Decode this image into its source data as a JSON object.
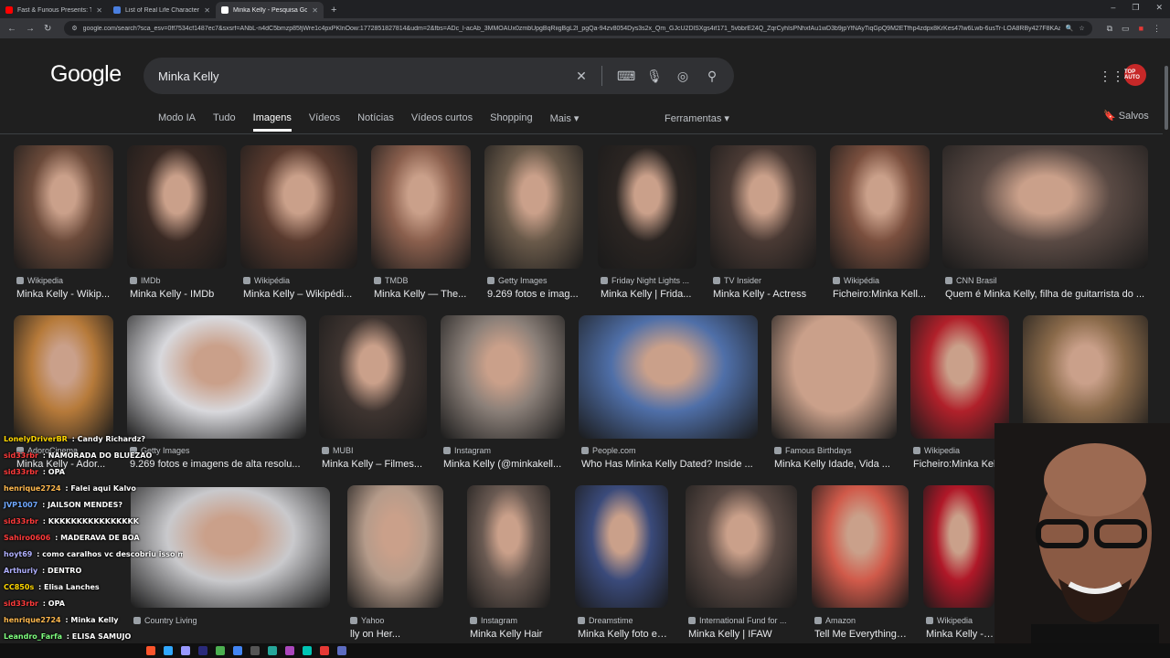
{
  "tabs": [
    {
      "title": "Fast & Furious Presents: Turbo",
      "fav": "#ff0000"
    },
    {
      "title": "List of Real Life Characters in D",
      "fav": "#4a7fe0"
    },
    {
      "title": "Minka Kelly - Pesquisa Google",
      "fav": "#ffffff"
    }
  ],
  "url": "google.com/search?sca_esv=0ff7534cf1487ec7&sxsrf=ANbL-n4dC5bmzp85fjWre1c4pxPKlnOow:1772851827814&udm=2&fbs=ADc_l-acAb_3MMOAUx0zmbUpgBqRiigBgL2l_pgQa-94zv8054Dys3s2x_Qm_GJcU2DlSXgs4if171_5vbbrE24Q_ZqrCyhIsPNhxfAu1wD3b9jpYfNAyTiqGpQ9M2ETfhp4zdpx8KrKes47lw6Lwb-6usTr-LOA8RBy427F8KAa4CS2tstri2f...",
  "search": {
    "query": "Minka Kelly"
  },
  "logo": "Google",
  "menu": [
    "Modo IA",
    "Tudo",
    "Imagens",
    "Vídeos",
    "Notícias",
    "Vídeos curtos",
    "Shopping",
    "Mais ▾"
  ],
  "tools_label": "Ferramentas ▾",
  "saved_label": "Salvos",
  "avatar_text": "TOP AUTO",
  "results": [
    {
      "source": "Wikipedia",
      "title": "Minka Kelly - Wikip...",
      "color": "#6b4a3a"
    },
    {
      "source": "IMDb",
      "title": "Minka Kelly - IMDb",
      "color": "#3a2a24"
    },
    {
      "source": "Wikipédia",
      "title": "Minka Kelly – Wikipédi...",
      "color": "#5a3b2f"
    },
    {
      "source": "TMDB",
      "title": "Minka Kelly — The...",
      "color": "#8a5f4d"
    },
    {
      "source": "Getty Images",
      "title": "9.269 fotos e imag...",
      "color": "#6a5a4a"
    },
    {
      "source": "Friday Night Lights ...",
      "title": "Minka Kelly | Frida...",
      "color": "#2b2522"
    },
    {
      "source": "TV Insider",
      "title": "Minka Kelly - Actress",
      "color": "#4a3a34"
    },
    {
      "source": "Wikipédia",
      "title": "Ficheiro:Minka Kell...",
      "color": "#7a4f3e"
    },
    {
      "source": "CNN Brasil",
      "title": "Quem é Minka Kelly, filha de guitarrista do ...",
      "color": "#5a4a44"
    },
    {
      "source": "AdoroCinema",
      "title": "Minka Kelly - Ador...",
      "color": "#b67a3a"
    },
    {
      "source": "Getty Images",
      "title": "9.269 fotos e imagens de alta resolu...",
      "color": "#d8d8dc"
    },
    {
      "source": "MUBI",
      "title": "Minka Kelly – Filmes...",
      "color": "#3e3430"
    },
    {
      "source": "Instagram",
      "title": "Minka Kelly (@minkakell...",
      "color": "#8a7f78"
    },
    {
      "source": "People.com",
      "title": "Who Has Minka Kelly Dated? Inside ...",
      "color": "#4f6fa8"
    },
    {
      "source": "Famous Birthdays",
      "title": "Minka Kelly Idade, Vida ...",
      "color": "#caa08a"
    },
    {
      "source": "Wikipedia",
      "title": "Ficheiro:Minka Kel...",
      "color": "#b0202a"
    },
    {
      "source": "",
      "title": "",
      "color": "#8a6a4a"
    },
    {
      "source": "Country Living",
      "title": "",
      "color": "#c9c9cc"
    },
    {
      "source": "Yahoo",
      "title": "lly on Her...",
      "color": "#b59b8a"
    },
    {
      "source": "Instagram",
      "title": "Minka Kelly Hair",
      "color": "#6a5a52"
    },
    {
      "source": "Dreamstime",
      "title": "Minka Kelly foto ed...",
      "color": "#3a4a7a"
    },
    {
      "source": "International Fund for ...",
      "title": "Minka Kelly | IFAW",
      "color": "#5a4a44"
    },
    {
      "source": "Amazon",
      "title": "Tell Me Everything:...",
      "color": "#d05a4a"
    },
    {
      "source": "Wikipedia",
      "title": "Minka Kelly - W",
      "color": "#b01828"
    }
  ],
  "chat": [
    {
      "name": "LonelyDriverBR",
      "msg": "Candy Richardz?",
      "color": "#ffd700"
    },
    {
      "name": "sid33rbr",
      "msg": "NAMORADA DO BLUEZAO",
      "color": "#ff3b3b"
    },
    {
      "name": "sid33rbr",
      "msg": "OPA",
      "color": "#ff3b3b"
    },
    {
      "name": "henrique2724",
      "msg": "Falei aqui Kalvo",
      "color": "#ffb84d"
    },
    {
      "name": "JVP1007",
      "msg": "JAILSON MENDES?",
      "color": "#6fa8ff"
    },
    {
      "name": "sid33rbr",
      "msg": "KKKKKKKKKKKKKKKK",
      "color": "#ff3b3b"
    },
    {
      "name": "Sahiro0606",
      "msg": "MADERAVA DE BOA",
      "color": "#ff3b3b"
    },
    {
      "name": "hoyt69",
      "msg": "como caralhos vc descobriu isso mn",
      "color": "#b0b0ff"
    },
    {
      "name": "Arthuriy",
      "msg": "DENTRO",
      "color": "#b0b0ff"
    },
    {
      "name": "CC850s",
      "msg": "Elisa Lanches",
      "color": "#ffd700"
    },
    {
      "name": "sid33rbr",
      "msg": "OPA",
      "color": "#ff3b3b"
    },
    {
      "name": "henrique2724",
      "msg": "Minka Kelly",
      "color": "#ffb84d"
    },
    {
      "name": "Leandro_Farfa",
      "msg": "ELISA SAMUJO",
      "color": "#7fff7f"
    }
  ]
}
